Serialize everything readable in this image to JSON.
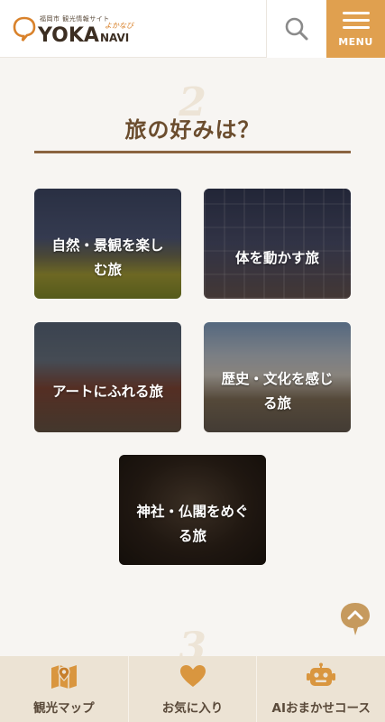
{
  "header": {
    "logo_sub": "福岡市 観光情報サイト",
    "logo_main": "YOKA",
    "logo_navi": "NAVI",
    "logo_kana": "よかなび",
    "menu_label": "MENU"
  },
  "section": {
    "step_number": "2",
    "title": "旅の好みは？",
    "next_step_number": "3"
  },
  "cards": [
    {
      "label": "自然・景観を楽しむ旅"
    },
    {
      "label": "体を動かす旅"
    },
    {
      "label": "アートにふれる旅"
    },
    {
      "label": "歴史・文化を感じる旅"
    },
    {
      "label": "神社・仏閣をめぐる旅"
    }
  ],
  "bottom_nav": [
    {
      "label": "観光マップ",
      "icon": "map-icon"
    },
    {
      "label": "お気に入り",
      "icon": "heart-icon"
    },
    {
      "label": "AIおまかせコース",
      "icon": "robot-icon"
    }
  ],
  "colors": {
    "accent": "#e0a04f",
    "title": "#6b4d2e",
    "nav_bg": "#ece3d4"
  }
}
